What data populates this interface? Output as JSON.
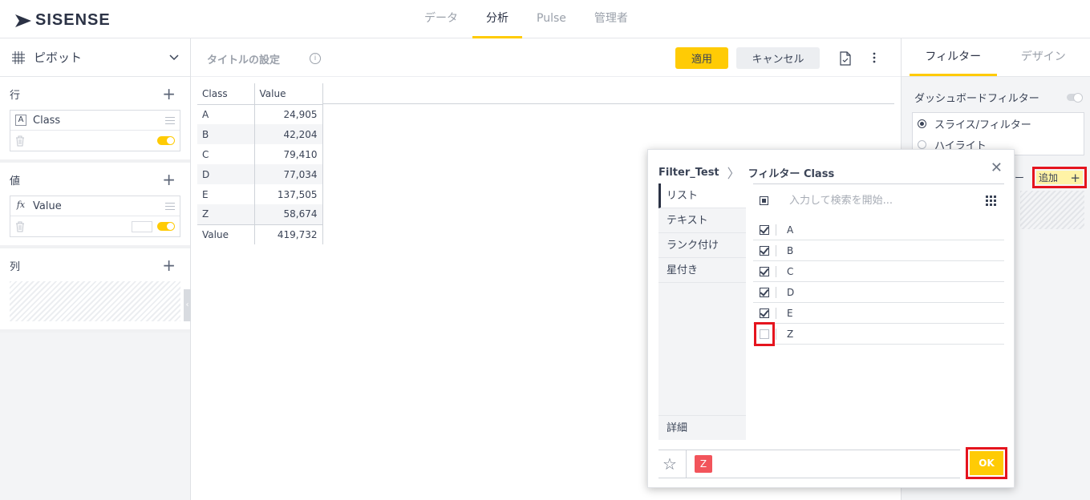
{
  "brand": {
    "name": "SISENSE",
    "accent": "#ffcb05"
  },
  "nav": [
    {
      "label": "データ",
      "active": false
    },
    {
      "label": "分析",
      "active": true
    },
    {
      "label": "Pulse",
      "active": false
    },
    {
      "label": "管理者",
      "active": false
    }
  ],
  "left": {
    "title": "ピボット",
    "rows": {
      "title": "行",
      "field": "Class",
      "field_type": "A"
    },
    "values": {
      "title": "値",
      "field": "Value",
      "field_type": "fx"
    },
    "columns": {
      "title": "列"
    }
  },
  "center": {
    "title_placeholder": "タイトルの設定",
    "apply_label": "適用",
    "cancel_label": "キャンセル"
  },
  "pivot": {
    "headers": [
      "Class",
      "Value"
    ],
    "rows": [
      [
        "A",
        "24,905"
      ],
      [
        "B",
        "42,204"
      ],
      [
        "C",
        "79,410"
      ],
      [
        "D",
        "77,034"
      ],
      [
        "E",
        "137,505"
      ],
      [
        "Z",
        "58,674"
      ]
    ],
    "total": [
      "Value",
      "419,732"
    ]
  },
  "right": {
    "tabs": [
      "フィルター",
      "デザイン"
    ],
    "dashboard_filter_label": "ダッシュボードフィルター",
    "mode_slice": "スライス/フィルター",
    "mode_highlight": "ハイライト",
    "partial_label": "ー",
    "add_label": "追加"
  },
  "dialog": {
    "breadcrumb_source": "Filter_Test",
    "breadcrumb_target": "フィルター Class",
    "tabs": [
      "リスト",
      "テキスト",
      "ランク付け",
      "星付き"
    ],
    "advanced_label": "詳細",
    "search_placeholder": "入力して検索を開始...",
    "items": [
      {
        "label": "A",
        "checked": true
      },
      {
        "label": "B",
        "checked": true
      },
      {
        "label": "C",
        "checked": true
      },
      {
        "label": "D",
        "checked": true
      },
      {
        "label": "E",
        "checked": true
      },
      {
        "label": "Z",
        "checked": false
      }
    ],
    "excluded_chip": "Z",
    "ok_label": "OK"
  }
}
